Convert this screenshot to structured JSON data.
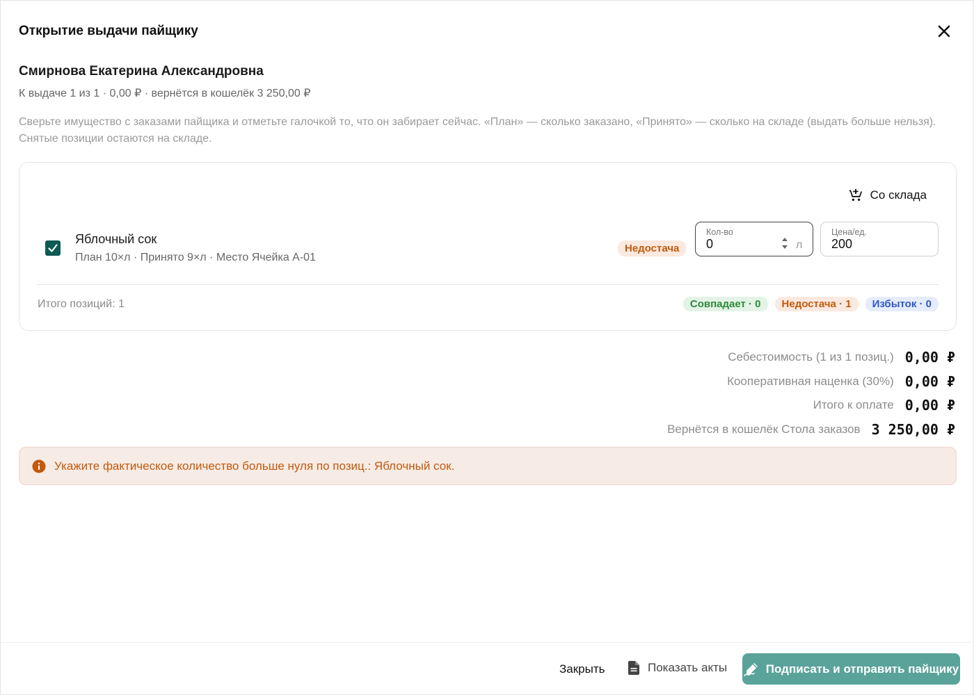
{
  "dialog": {
    "title": "Открытие выдачи пайщику"
  },
  "member": {
    "name": "Смирнова Екатерина Александровна",
    "summary": "К выдаче 1 из 1 · 0,00 ₽ · вернётся в кошелёк 3 250,00 ₽"
  },
  "instructions": "Сверьте имущество с заказами пайщика и отметьте галочкой то, что он забирает сейчас. «План» — сколько заказано, «Принято» — сколько на складе (выдать больше нельзя). Снятые позиции остаются на складе.",
  "card": {
    "from_stock_label": "Со склада",
    "items": [
      {
        "checked": true,
        "name": "Яблочный сок",
        "meta": "План 10×л · Принято 9×л · Место Ячейка A-01",
        "status": "Недостача",
        "qty_label": "Кол-во",
        "qty_value": "0",
        "unit": "л",
        "price_label": "Цена/ед.",
        "price_value": "200"
      }
    ],
    "total_positions": "Итого позиций: 1",
    "summary_badges": {
      "match": "Совпадает · 0",
      "shortage": "Недостача · 1",
      "surplus": "Избыток · 0"
    }
  },
  "totals": [
    {
      "label": "Себестоимость (1 из 1 позиц.)",
      "value": "0,00 ₽"
    },
    {
      "label": "Кооперативная наценка (30%)",
      "value": "0,00 ₽"
    },
    {
      "label": "Итого к оплате",
      "value": "0,00 ₽"
    },
    {
      "label": "Вернётся в кошелёк Стола заказов",
      "value": "3 250,00 ₽"
    }
  ],
  "alert": {
    "text": "Укажите фактическое количество больше нуля по позиц.: Яблочный сок."
  },
  "footer": {
    "close_label": "Закрыть",
    "acts_label": "Показать акты",
    "sign_label": "Подписать и отправить пайщику"
  },
  "colors": {
    "accent": "#0f5a52",
    "primary_button": "#5aa39a",
    "warning": "#c25a0e",
    "success": "#2f8a3c",
    "info": "#2f58c7"
  },
  "icons": {
    "close": "close-icon",
    "from_stock": "cart-add-icon",
    "checkbox": "check-icon",
    "stepper": "stepper-arrows-icon",
    "alert": "info-icon",
    "acts": "document-icon",
    "sign": "signature-icon"
  }
}
